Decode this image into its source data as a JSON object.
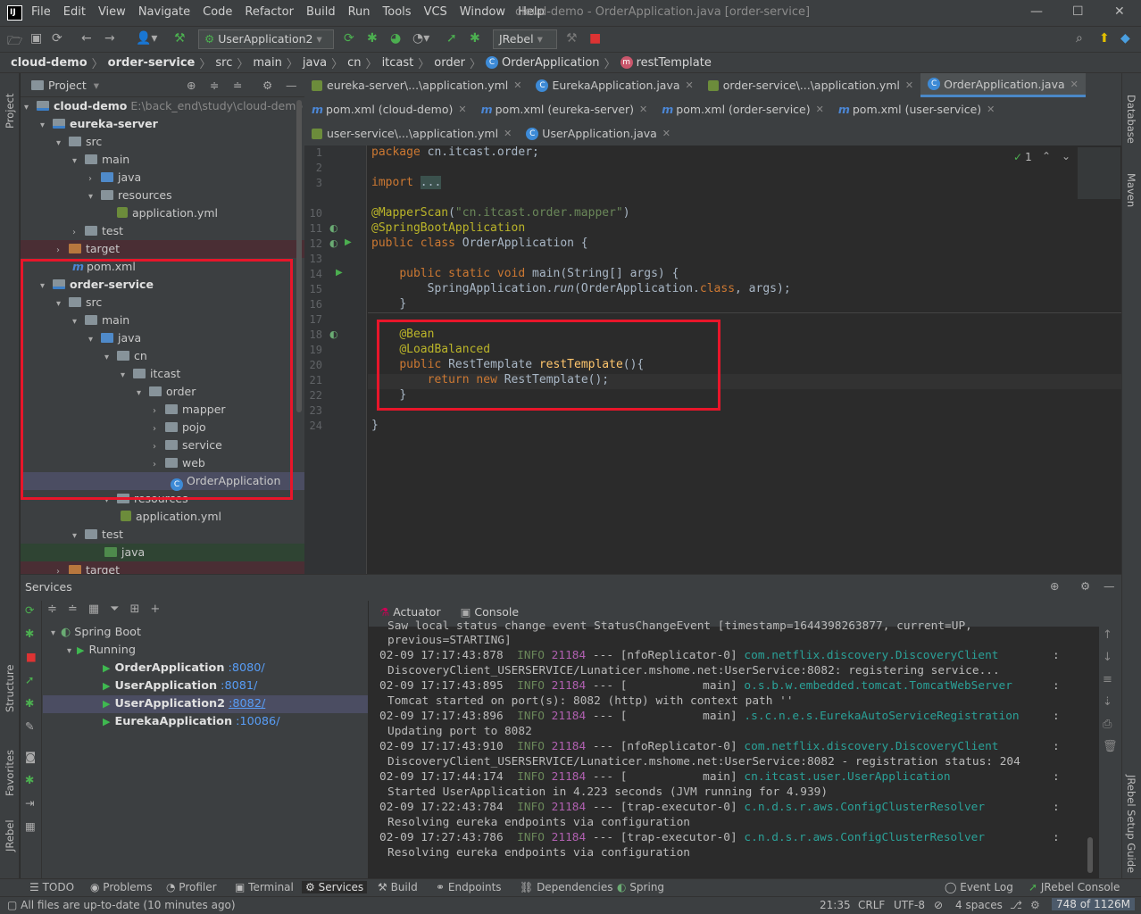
{
  "window": {
    "title": "cloud-demo - OrderApplication.java [order-service]",
    "menus": [
      "File",
      "Edit",
      "View",
      "Navigate",
      "Code",
      "Refactor",
      "Build",
      "Run",
      "Tools",
      "VCS",
      "Window",
      "Help"
    ]
  },
  "toolbar": {
    "run_config": "UserApplication2",
    "jrebel": "JRebel"
  },
  "breadcrumb": [
    "cloud-demo",
    "order-service",
    "src",
    "main",
    "java",
    "cn",
    "itcast",
    "order",
    "OrderApplication",
    "restTemplate"
  ],
  "project": {
    "header": "Project",
    "root_label": "cloud-demo",
    "root_path": "E:\\back_end\\study\\cloud-demo",
    "nodes": [
      "eureka-server",
      "src",
      "main",
      "java",
      "resources",
      "application.yml",
      "test",
      "target",
      "pom.xml",
      "order-service",
      "src",
      "main",
      "java",
      "cn",
      "itcast",
      "order",
      "mapper",
      "pojo",
      "service",
      "web",
      "OrderApplication",
      "resources",
      "application.yml",
      "test",
      "java",
      "target"
    ]
  },
  "tabs": {
    "row1": [
      "eureka-server\\...\\application.yml",
      "EurekaApplication.java",
      "order-service\\...\\application.yml",
      "OrderApplication.java"
    ],
    "row2": [
      "pom.xml (cloud-demo)",
      "pom.xml (eureka-server)",
      "pom.xml (order-service)",
      "pom.xml (user-service)"
    ],
    "row3": [
      "user-service\\...\\application.yml",
      "UserApplication.java"
    ]
  },
  "editor": {
    "line_numbers": [
      "1",
      "2",
      "3",
      "10",
      "11",
      "12",
      "13",
      "14",
      "15",
      "16",
      "17",
      "18",
      "19",
      "20",
      "21",
      "22",
      "23",
      "24"
    ],
    "inspection_count": "1",
    "code": {
      "package_kw": "package",
      "package_name": " cn.itcast.order;",
      "import_kw": "import",
      "import_fold": "...",
      "mapperscan": "@MapperScan",
      "mapperscan_arg": "\"cn.itcast.order.mapper\"",
      "springboot": "@SpringBootApplication",
      "class_decl_kw": "public class",
      "class_name": " OrderApplication {",
      "main_kw": "public static void",
      "main_sig": " main(String[] args) {",
      "run_line_a": "SpringApplication.",
      "run_line_b": "run",
      "run_line_c": "(OrderApplication.",
      "run_line_d": "class",
      "run_line_e": ", args);",
      "close1": "}",
      "bean": "@Bean",
      "lb": "@LoadBalanced",
      "rt_kw": "public",
      "rt_type": " RestTemplate ",
      "rt_fn": "restTemplate",
      "rt_rest": "(){",
      "ret_kw": "return new",
      "ret_rest": " RestTemplate();",
      "close2": "}",
      "close3": "}"
    }
  },
  "services": {
    "title": "Services",
    "tree": {
      "spring_boot": "Spring Boot",
      "running": "Running",
      "apps": [
        {
          "name": "OrderApplication",
          "port": ":8080/"
        },
        {
          "name": "UserApplication",
          "port": ":8081/"
        },
        {
          "name": "UserApplication2",
          "port": ":8082/"
        },
        {
          "name": "EurekaApplication",
          "port": ":10086/"
        }
      ]
    },
    "tabs": [
      "Actuator",
      "Console"
    ]
  },
  "console": [
    {
      "t": "Saw local status change event StatusChangeEvent [timestamp=1644398263877, current=UP,"
    },
    {
      "t": "previous=STARTING]"
    },
    {
      "ts": "02-09 17:17:43:878",
      "lvl": "INFO",
      "pid": "21184",
      "thr": "--- [nfoReplicator-0]",
      "cls": "com.netflix.discovery.DiscoveryClient",
      "msg": "DiscoveryClient_USERSERVICE/Lunaticer.mshome.net:UserService:8082: registering service..."
    },
    {
      "ts": "02-09 17:17:43:895",
      "lvl": "INFO",
      "pid": "21184",
      "thr": "--- [           main]",
      "cls": "o.s.b.w.embedded.tomcat.TomcatWebServer",
      "msg": "Tomcat started on port(s): 8082 (http) with context path ''"
    },
    {
      "ts": "02-09 17:17:43:896",
      "lvl": "INFO",
      "pid": "21184",
      "thr": "--- [           main]",
      "cls": ".s.c.n.e.s.EurekaAutoServiceRegistration",
      "msg": "Updating port to 8082"
    },
    {
      "ts": "02-09 17:17:43:910",
      "lvl": "INFO",
      "pid": "21184",
      "thr": "--- [nfoReplicator-0]",
      "cls": "com.netflix.discovery.DiscoveryClient",
      "msg": "DiscoveryClient_USERSERVICE/Lunaticer.mshome.net:UserService:8082 - registration status: 204"
    },
    {
      "ts": "02-09 17:17:44:174",
      "lvl": "INFO",
      "pid": "21184",
      "thr": "--- [           main]",
      "cls": "cn.itcast.user.UserApplication",
      "msg": "Started UserApplication in 4.223 seconds (JVM running for 4.939)"
    },
    {
      "ts": "02-09 17:22:43:784",
      "lvl": "INFO",
      "pid": "21184",
      "thr": "--- [trap-executor-0]",
      "cls": "c.n.d.s.r.aws.ConfigClusterResolver",
      "msg": "Resolving eureka endpoints via configuration"
    },
    {
      "ts": "02-09 17:27:43:786",
      "lvl": "INFO",
      "pid": "21184",
      "thr": "--- [trap-executor-0]",
      "cls": "c.n.d.s.r.aws.ConfigClusterResolver",
      "msg": "Resolving eureka endpoints via configuration"
    }
  ],
  "bottom_tabs": [
    "TODO",
    "Problems",
    "Profiler",
    "Terminal",
    "Services",
    "Build",
    "Endpoints",
    "Dependencies",
    "Spring"
  ],
  "bottom_right": [
    "Event Log",
    "JRebel Console"
  ],
  "status": {
    "message": "All files are up-to-date (10 minutes ago)",
    "pos": "21:35",
    "eol": "CRLF",
    "enc": "UTF-8",
    "indent": "4 spaces",
    "memory": "748 of 1126M"
  },
  "side": {
    "left": [
      "Project",
      "Structure",
      "Favorites",
      "JRebel"
    ],
    "right": [
      "Database",
      "Maven",
      "JRebel Setup Guide"
    ]
  }
}
